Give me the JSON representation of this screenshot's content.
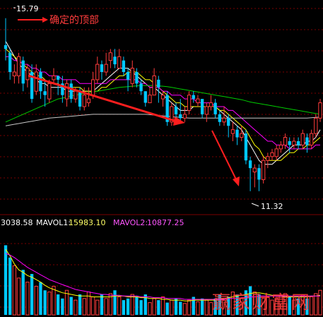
{
  "chart_data": [
    {
      "type": "candlestick",
      "title": "",
      "annotations": {
        "top_note": "确定的顶部",
        "high_label": "15.79",
        "low_label": "11.32"
      },
      "y_range": [
        10.8,
        16.2
      ],
      "candles": [
        [
          15.1,
          15.0,
          15.8,
          14.7
        ],
        [
          14.9,
          14.4,
          15.0,
          14.2
        ],
        [
          14.3,
          14.4,
          14.6,
          14.1
        ],
        [
          14.3,
          14.8,
          14.9,
          14.1
        ],
        [
          14.7,
          14.1,
          14.8,
          13.9
        ],
        [
          14.2,
          14.5,
          14.6,
          14.0
        ],
        [
          14.4,
          13.7,
          14.6,
          13.6
        ],
        [
          13.9,
          14.4,
          14.6,
          13.8
        ],
        [
          14.4,
          13.9,
          14.5,
          13.7
        ],
        [
          13.9,
          13.8,
          14.2,
          13.5
        ],
        [
          13.7,
          14.1,
          14.2,
          13.6
        ],
        [
          14.2,
          14.3,
          14.5,
          14.1
        ],
        [
          14.3,
          14.2,
          14.3,
          13.8
        ],
        [
          14.1,
          13.8,
          14.3,
          13.6
        ],
        [
          13.7,
          14.1,
          14.2,
          13.5
        ],
        [
          14.1,
          13.7,
          14.2,
          13.6
        ],
        [
          13.7,
          13.9,
          14.0,
          13.6
        ],
        [
          13.9,
          13.5,
          14.0,
          13.4
        ],
        [
          13.5,
          13.8,
          14.0,
          13.4
        ],
        [
          13.6,
          13.7,
          14.0,
          13.5
        ],
        [
          13.8,
          14.2,
          14.4,
          13.7
        ],
        [
          14.2,
          14.6,
          14.8,
          14.1
        ],
        [
          14.6,
          14.4,
          14.7,
          14.2
        ],
        [
          14.4,
          14.6,
          14.9,
          14.3
        ],
        [
          14.7,
          14.9,
          15.0,
          14.5
        ],
        [
          14.8,
          14.6,
          15.0,
          14.5
        ],
        [
          14.5,
          14.8,
          15.0,
          14.5
        ],
        [
          14.7,
          14.4,
          14.8,
          14.3
        ],
        [
          14.4,
          14.2,
          14.5,
          13.9
        ],
        [
          14.1,
          14.5,
          14.7,
          14.0
        ],
        [
          14.4,
          14.1,
          14.5,
          14.0
        ],
        [
          14.1,
          13.9,
          14.2,
          13.8
        ],
        [
          13.9,
          13.6,
          13.9,
          13.5
        ],
        [
          13.6,
          13.8,
          14.0,
          13.6
        ],
        [
          13.8,
          14.3,
          14.5,
          13.8
        ],
        [
          14.2,
          14.0,
          14.3,
          13.6
        ],
        [
          13.7,
          13.8,
          13.9,
          13.5
        ],
        [
          13.8,
          13.1,
          13.9,
          13.0
        ],
        [
          13.1,
          13.5,
          13.6,
          13.0
        ],
        [
          13.5,
          13.3,
          13.6,
          13.1
        ],
        [
          13.3,
          13.2,
          13.7,
          13.1
        ],
        [
          13.2,
          13.3,
          13.5,
          13.1
        ],
        [
          13.4,
          13.8,
          13.9,
          13.3
        ],
        [
          13.8,
          13.7,
          13.9,
          13.6
        ],
        [
          13.6,
          13.7,
          13.8,
          13.5
        ],
        [
          13.7,
          13.3,
          13.7,
          13.2
        ],
        [
          13.3,
          13.5,
          13.6,
          13.1
        ],
        [
          13.5,
          13.6,
          13.8,
          13.4
        ],
        [
          13.6,
          13.3,
          13.7,
          13.2
        ],
        [
          13.3,
          13.1,
          13.4,
          13.0
        ],
        [
          13.1,
          13.2,
          13.5,
          13.0
        ],
        [
          13.2,
          13.0,
          13.3,
          12.7
        ],
        [
          12.8,
          12.9,
          13.1,
          12.6
        ],
        [
          12.9,
          12.7,
          13.0,
          12.5
        ],
        [
          12.7,
          12.8,
          13.0,
          12.6
        ],
        [
          12.8,
          12.1,
          12.9,
          12.0
        ],
        [
          12.1,
          11.9,
          12.2,
          11.3
        ],
        [
          11.8,
          11.9,
          12.0,
          11.4
        ],
        [
          11.9,
          11.6,
          12.0,
          11.3
        ],
        [
          11.6,
          12.1,
          12.2,
          11.5
        ],
        [
          12.1,
          12.2,
          12.3,
          11.9
        ],
        [
          12.2,
          12.3,
          12.4,
          12.1
        ],
        [
          12.2,
          12.4,
          12.5,
          12.1
        ],
        [
          12.4,
          12.5,
          12.6,
          12.3
        ],
        [
          12.5,
          12.7,
          12.8,
          12.4
        ],
        [
          12.6,
          12.5,
          12.7,
          12.3
        ],
        [
          12.5,
          12.6,
          12.7,
          12.4
        ],
        [
          12.6,
          12.5,
          12.7,
          12.4
        ],
        [
          12.5,
          12.8,
          12.9,
          12.4
        ],
        [
          12.7,
          12.5,
          12.8,
          12.3
        ],
        [
          12.5,
          12.8,
          12.9,
          12.4
        ],
        [
          12.8,
          13.2,
          13.3,
          12.7
        ],
        [
          13.2,
          13.6,
          13.7,
          13.1
        ]
      ],
      "moving_averages": [
        {
          "color": "#ffffff",
          "values": [
            15.2,
            15.0,
            14.8,
            14.6,
            14.5,
            14.4,
            14.3,
            14.2,
            14.1,
            14.1,
            14.0,
            14.0,
            14.0,
            14.0,
            13.9,
            13.9,
            13.9,
            13.9,
            13.9,
            13.9,
            13.9,
            14.0,
            14.1,
            14.2,
            14.3,
            14.4,
            14.5,
            14.5,
            14.5,
            14.4,
            14.3,
            14.2,
            14.1,
            14.0,
            14.0,
            13.9,
            13.8,
            13.7,
            13.6,
            13.5,
            13.4,
            13.4,
            13.4,
            13.5,
            13.5,
            13.5,
            13.5,
            13.5,
            13.5,
            13.4,
            13.3,
            13.2,
            13.1,
            13.0,
            12.9,
            12.7,
            12.5,
            12.3,
            12.1,
            12.0,
            12.0,
            12.0,
            12.1,
            12.2,
            12.3,
            12.4,
            12.5,
            12.5,
            12.5,
            12.6,
            12.6,
            12.7,
            12.9
          ]
        },
        {
          "color": "#ffff00",
          "values": [
            15.0,
            14.9,
            14.8,
            14.7,
            14.6,
            14.5,
            14.4,
            14.3,
            14.3,
            14.2,
            14.1,
            14.1,
            14.1,
            14.0,
            14.0,
            14.0,
            14.0,
            14.0,
            13.9,
            13.9,
            13.9,
            13.9,
            14.0,
            14.0,
            14.1,
            14.2,
            14.3,
            14.3,
            14.4,
            14.4,
            14.4,
            14.3,
            14.2,
            14.2,
            14.1,
            14.0,
            13.9,
            13.8,
            13.7,
            13.6,
            13.6,
            13.5,
            13.5,
            13.5,
            13.5,
            13.5,
            13.5,
            13.5,
            13.5,
            13.4,
            13.4,
            13.3,
            13.2,
            13.1,
            13.0,
            12.9,
            12.7,
            12.5,
            12.4,
            12.2,
            12.1,
            12.1,
            12.1,
            12.1,
            12.2,
            12.3,
            12.3,
            12.4,
            12.4,
            12.5,
            12.5,
            12.6,
            12.7
          ]
        },
        {
          "color": "#ff00ff",
          "values": [
            14.8,
            14.8,
            14.7,
            14.7,
            14.6,
            14.6,
            14.5,
            14.5,
            14.4,
            14.4,
            14.3,
            14.3,
            14.3,
            14.2,
            14.2,
            14.2,
            14.2,
            14.1,
            14.1,
            14.1,
            14.1,
            14.1,
            14.1,
            14.1,
            14.2,
            14.2,
            14.2,
            14.2,
            14.2,
            14.2,
            14.2,
            14.1,
            14.1,
            14.0,
            14.0,
            14.0,
            13.9,
            13.9,
            13.8,
            13.8,
            13.8,
            13.7,
            13.7,
            13.7,
            13.6,
            13.6,
            13.6,
            13.6,
            13.5,
            13.5,
            13.5,
            13.4,
            13.4,
            13.3,
            13.2,
            13.1,
            13.0,
            12.9,
            12.8,
            12.7,
            12.6,
            12.6,
            12.5,
            12.5,
            12.5,
            12.4,
            12.4,
            12.4,
            12.4,
            12.4,
            12.4,
            12.5,
            12.5
          ]
        },
        {
          "color": "#00cc00",
          "values": [
            13.1,
            13.15,
            13.2,
            13.25,
            13.3,
            13.35,
            13.4,
            13.45,
            13.5,
            13.55,
            13.6,
            13.65,
            13.7,
            13.72,
            13.75,
            13.78,
            13.8,
            13.82,
            13.84,
            13.86,
            13.88,
            13.9,
            13.92,
            13.94,
            13.96,
            13.98,
            14.0,
            14.01,
            14.02,
            14.03,
            14.04,
            14.05,
            14.05,
            14.05,
            14.05,
            14.04,
            14.03,
            14.02,
            14.0,
            13.98,
            13.96,
            13.94,
            13.92,
            13.9,
            13.88,
            13.86,
            13.84,
            13.82,
            13.8,
            13.78,
            13.76,
            13.74,
            13.72,
            13.7,
            13.68,
            13.65,
            13.62,
            13.6,
            13.58,
            13.56,
            13.54,
            13.52,
            13.5,
            13.48,
            13.46,
            13.44,
            13.42,
            13.4,
            13.38,
            13.36,
            13.34,
            13.32,
            13.3
          ]
        },
        {
          "color": "#c8c8c8",
          "values": [
            13.0,
            13.02,
            13.04,
            13.06,
            13.08,
            13.1,
            13.12,
            13.14,
            13.16,
            13.18,
            13.2,
            13.21,
            13.22,
            13.23,
            13.24,
            13.25,
            13.26,
            13.27,
            13.28,
            13.29,
            13.3,
            13.3,
            13.3,
            13.3,
            13.3,
            13.3,
            13.3,
            13.3,
            13.3,
            13.3,
            13.3,
            13.3,
            13.3,
            13.29,
            13.28,
            13.27,
            13.26,
            13.25,
            13.24,
            13.23,
            13.22,
            13.21,
            13.2,
            13.2,
            13.2,
            13.2,
            13.2,
            13.2,
            13.2,
            13.2,
            13.2,
            13.2,
            13.2,
            13.2,
            13.2,
            13.2,
            13.2,
            13.2,
            13.2,
            13.2,
            13.2,
            13.2,
            13.2,
            13.2,
            13.2,
            13.2,
            13.2,
            13.2,
            13.2,
            13.2,
            13.21,
            13.22,
            13.23
          ]
        }
      ]
    },
    {
      "type": "bar",
      "title": "",
      "legend_text": {
        "value": "3038.58",
        "mavol1_label": "MAVOL1:",
        "mavol1_value": "15983.10",
        "mavol2_label": "MAVOL2:",
        "mavol2_value": "10877.25"
      },
      "y_range": [
        0,
        100
      ],
      "volumes": [
        85,
        70,
        60,
        45,
        55,
        40,
        50,
        35,
        40,
        30,
        28,
        35,
        25,
        20,
        30,
        22,
        18,
        25,
        20,
        28,
        22,
        18,
        25,
        20,
        26,
        30,
        22,
        18,
        20,
        25,
        22,
        18,
        25,
        15,
        20,
        18,
        22,
        15,
        18,
        20,
        16,
        14,
        18,
        22,
        16,
        20,
        18,
        15,
        20,
        25,
        18,
        22,
        28,
        25,
        20,
        30,
        35,
        28,
        25,
        20,
        22,
        18,
        20,
        24,
        26,
        22,
        18,
        20,
        24,
        20,
        22,
        26,
        30
      ],
      "up_color": "#ff3c3c",
      "down_color": "#00c8ff",
      "moving_averages": [
        {
          "color": "#ffff00",
          "values": [
            80,
            72,
            62,
            55,
            52,
            48,
            46,
            43,
            40,
            36,
            33,
            31,
            29,
            27,
            26,
            25,
            24,
            23,
            23,
            23,
            22,
            22,
            22,
            22,
            22,
            23,
            23,
            23,
            22,
            22,
            22,
            21,
            21,
            20,
            20,
            20,
            19,
            19,
            18,
            18,
            18,
            17,
            17,
            18,
            18,
            18,
            18,
            18,
            18,
            19,
            20,
            21,
            22,
            23,
            24,
            25,
            26,
            27,
            27,
            26,
            25,
            24,
            23,
            23,
            22,
            22,
            22,
            22,
            22,
            22,
            23,
            23,
            24
          ]
        },
        {
          "color": "#ff00ff",
          "values": [
            75,
            73,
            70,
            66,
            62,
            58,
            55,
            52,
            49,
            46,
            43,
            41,
            39,
            37,
            35,
            33,
            31,
            30,
            29,
            28,
            27,
            26,
            25,
            25,
            24,
            24,
            24,
            23,
            23,
            23,
            23,
            22,
            22,
            22,
            21,
            21,
            21,
            20,
            20,
            20,
            20,
            19,
            19,
            19,
            19,
            19,
            19,
            19,
            19,
            19,
            19,
            20,
            20,
            20,
            21,
            21,
            22,
            22,
            23,
            23,
            23,
            23,
            23,
            23,
            23,
            23,
            23,
            23,
            23,
            23,
            23,
            23,
            23
          ]
        }
      ]
    }
  ],
  "watermark": "赢家财富网",
  "colors": {
    "background": "#000000",
    "grid": "#7a0000",
    "up": "#ff3c3c",
    "down": "#00c8ff",
    "arrow": "#ff1e1e",
    "text_white": "#ffffff",
    "text_yellow": "#ffff66",
    "text_magenta": "#ff55ff"
  }
}
